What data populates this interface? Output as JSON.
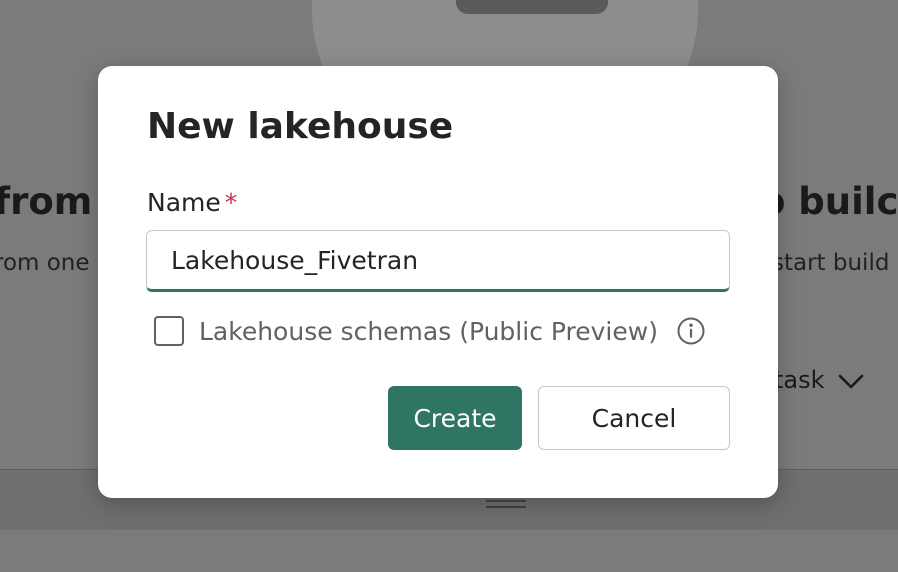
{
  "background": {
    "heading_left": "from p",
    "heading_right": "o builc",
    "subtitle_left": "rom one",
    "subtitle_right": "start build",
    "task_text": "task",
    "chevron_icon": "chevron-down-icon",
    "handle_icon": "hamburger-icon"
  },
  "dialog": {
    "title": "New lakehouse",
    "name_label": "Name",
    "required_mark": "*",
    "name_value": "Lakehouse_Fivetran",
    "schemas_checkbox_checked": false,
    "schemas_label": "Lakehouse schemas (Public Preview)",
    "info_icon": "info-icon",
    "create_label": "Create",
    "cancel_label": "Cancel"
  },
  "colors": {
    "accent": "#2f7563",
    "required": "#c4314b",
    "overlay": "#7b7b7b",
    "text": "#242424",
    "muted_text": "#616161"
  }
}
